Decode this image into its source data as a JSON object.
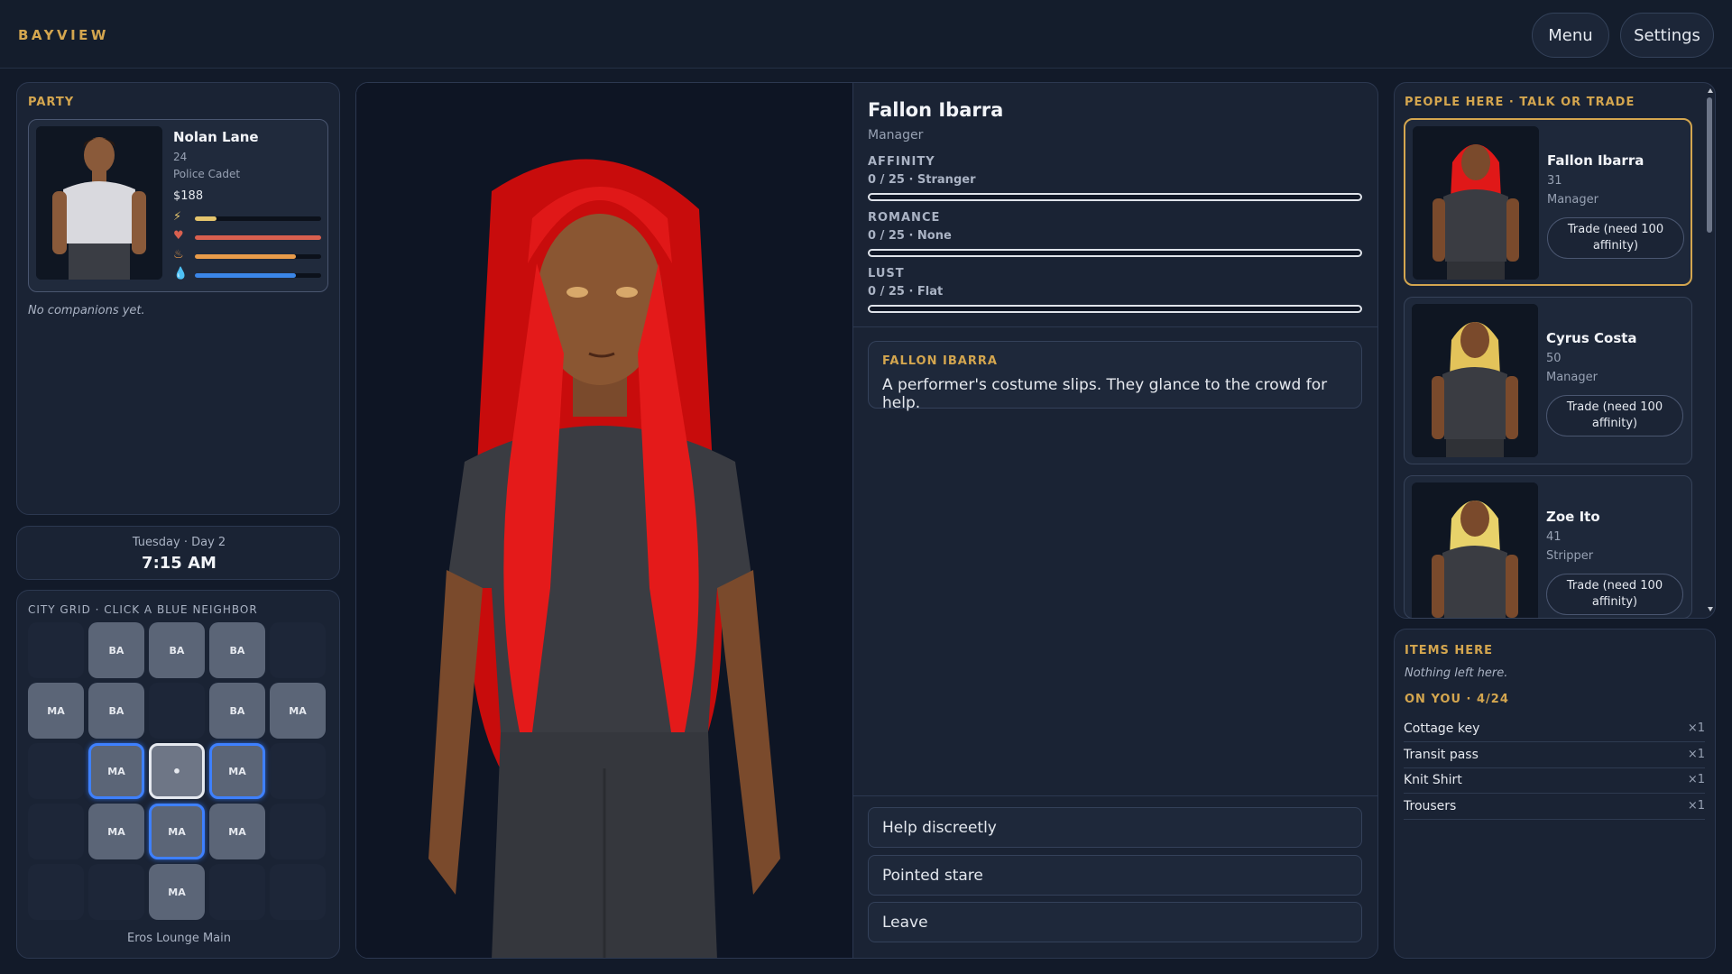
{
  "app": {
    "brand": "BAYVIEW"
  },
  "topbar": {
    "menu_label": "Menu",
    "settings_label": "Settings"
  },
  "party": {
    "title": "PARTY",
    "member": {
      "name": "Nolan Lane",
      "age": "24",
      "role": "Police Cadet",
      "money": "$188",
      "stats": [
        {
          "icon": "energy-icon",
          "level": 0.17,
          "color": "#e4c46d"
        },
        {
          "icon": "heart-icon",
          "level": 1.0,
          "color": "#d9604f"
        },
        {
          "icon": "food-icon",
          "level": 0.8,
          "color": "#e89b4a"
        },
        {
          "icon": "water-icon",
          "level": 0.8,
          "color": "#3b86e8"
        }
      ]
    },
    "companions_note": "No companions yet."
  },
  "clock": {
    "day": "Tuesday · Day 2",
    "time": "7:15 AM"
  },
  "city_grid": {
    "title": "CITY GRID · CLICK A BLUE NEIGHBOR",
    "location": "Eros Lounge Main",
    "current_marker": "•",
    "cells": [
      {
        "label": "BA",
        "row": 0,
        "col": 1,
        "state": "normal"
      },
      {
        "label": "BA",
        "row": 0,
        "col": 2,
        "state": "normal"
      },
      {
        "label": "BA",
        "row": 0,
        "col": 3,
        "state": "normal"
      },
      {
        "label": "MA",
        "row": 1,
        "col": 0,
        "state": "normal"
      },
      {
        "label": "BA",
        "row": 1,
        "col": 1,
        "state": "normal"
      },
      {
        "label": "BA",
        "row": 1,
        "col": 3,
        "state": "normal"
      },
      {
        "label": "MA",
        "row": 1,
        "col": 4,
        "state": "normal"
      },
      {
        "label": "MA",
        "row": 2,
        "col": 1,
        "state": "blue"
      },
      {
        "label": "•",
        "row": 2,
        "col": 2,
        "state": "current"
      },
      {
        "label": "MA",
        "row": 2,
        "col": 3,
        "state": "blue"
      },
      {
        "label": "MA",
        "row": 3,
        "col": 1,
        "state": "normal"
      },
      {
        "label": "MA",
        "row": 3,
        "col": 2,
        "state": "blue"
      },
      {
        "label": "MA",
        "row": 3,
        "col": 3,
        "state": "normal"
      },
      {
        "label": "MA",
        "row": 4,
        "col": 2,
        "state": "normal"
      }
    ]
  },
  "npc": {
    "name": "Fallon Ibarra",
    "role": "Manager",
    "meters": [
      {
        "label": "AFFINITY",
        "value": "0 / 25 · Stranger",
        "level": 0
      },
      {
        "label": "ROMANCE",
        "value": "0 / 25 · None",
        "level": 0
      },
      {
        "label": "LUST",
        "value": "0 / 25 · Flat",
        "level": 0
      }
    ]
  },
  "dialogue": {
    "speaker": "FALLON IBARRA",
    "text": "A performer's costume slips. They glance to the crowd for help."
  },
  "choices": [
    "Help discreetly",
    "Pointed stare",
    "Leave"
  ],
  "people": {
    "title": "PEOPLE HERE · TALK OR TRADE",
    "list": [
      {
        "name": "Fallon Ibarra",
        "age": "31",
        "role": "Manager",
        "trade": "Trade (need 100 affinity)",
        "hair": "#e01818",
        "selected": true
      },
      {
        "name": "Cyrus Costa",
        "age": "50",
        "role": "Manager",
        "trade": "Trade (need 100 affinity)",
        "hair": "#e3c35a",
        "selected": false
      },
      {
        "name": "Zoe Ito",
        "age": "41",
        "role": "Stripper",
        "trade": "Trade (need 100 affinity)",
        "hair": "#e8d26a",
        "selected": false
      }
    ]
  },
  "items": {
    "title": "ITEMS HERE",
    "empty_note": "Nothing left here.",
    "inventory_title": "ON YOU · 4/24",
    "inventory": [
      {
        "name": "Cottage key",
        "qty": "×1"
      },
      {
        "name": "Transit pass",
        "qty": "×1"
      },
      {
        "name": "Knit Shirt",
        "qty": "×1"
      },
      {
        "name": "Trousers",
        "qty": "×1"
      }
    ]
  }
}
